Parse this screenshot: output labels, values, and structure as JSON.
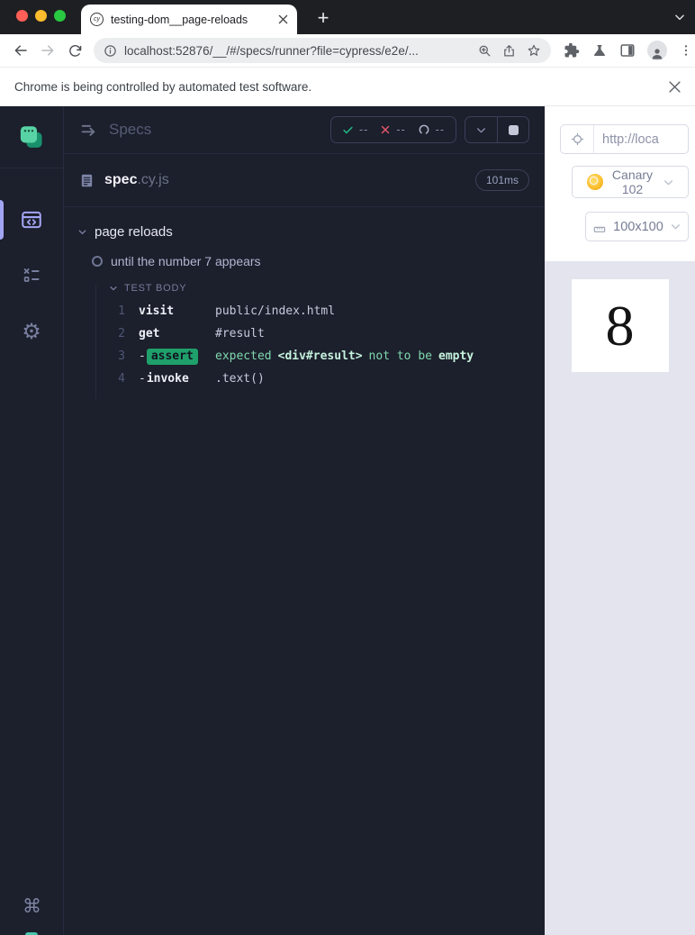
{
  "chrome": {
    "tab_title": "testing-dom__page-reloads",
    "tab_favicon": "cy",
    "url": "localhost:52876/__/#/specs/runner?file=cypress/e2e/...",
    "infobar_text": "Chrome is being controlled by automated test software."
  },
  "reporter": {
    "title": "Specs",
    "stats": {
      "passed": "--",
      "failed": "--",
      "pending": "--"
    },
    "spec_name": "spec",
    "spec_ext": ".cy.js",
    "spec_duration": "101ms",
    "suite": "page reloads",
    "test": "until the number 7 appears",
    "section": "TEST BODY",
    "commands": [
      {
        "num": "1",
        "name": "visit",
        "message": "public/index.html"
      },
      {
        "num": "2",
        "name": "get",
        "message": "#result"
      },
      {
        "num": "3",
        "dash": "-",
        "name": "assert",
        "parts": [
          {
            "text": "expected"
          },
          {
            "text": "<div#result>",
            "bold": true
          },
          {
            "text": "not to be"
          },
          {
            "text": "empty",
            "bold": true
          }
        ]
      },
      {
        "num": "4",
        "dash": "-",
        "name": "invoke",
        "message": ".text()"
      }
    ]
  },
  "aut": {
    "url": "http://loca",
    "browser": "Canary 102",
    "viewport": "100x100",
    "result": "8"
  },
  "colors": {
    "accent_purple": "#a2a5f3",
    "cypress_green": "#58d3a5",
    "pass_green": "#21b07c",
    "fail_red": "#e2566a",
    "assert_badge_green": "#1fa06b",
    "app_background": "#1c1f2c",
    "aut_background": "#e3e4ed"
  }
}
